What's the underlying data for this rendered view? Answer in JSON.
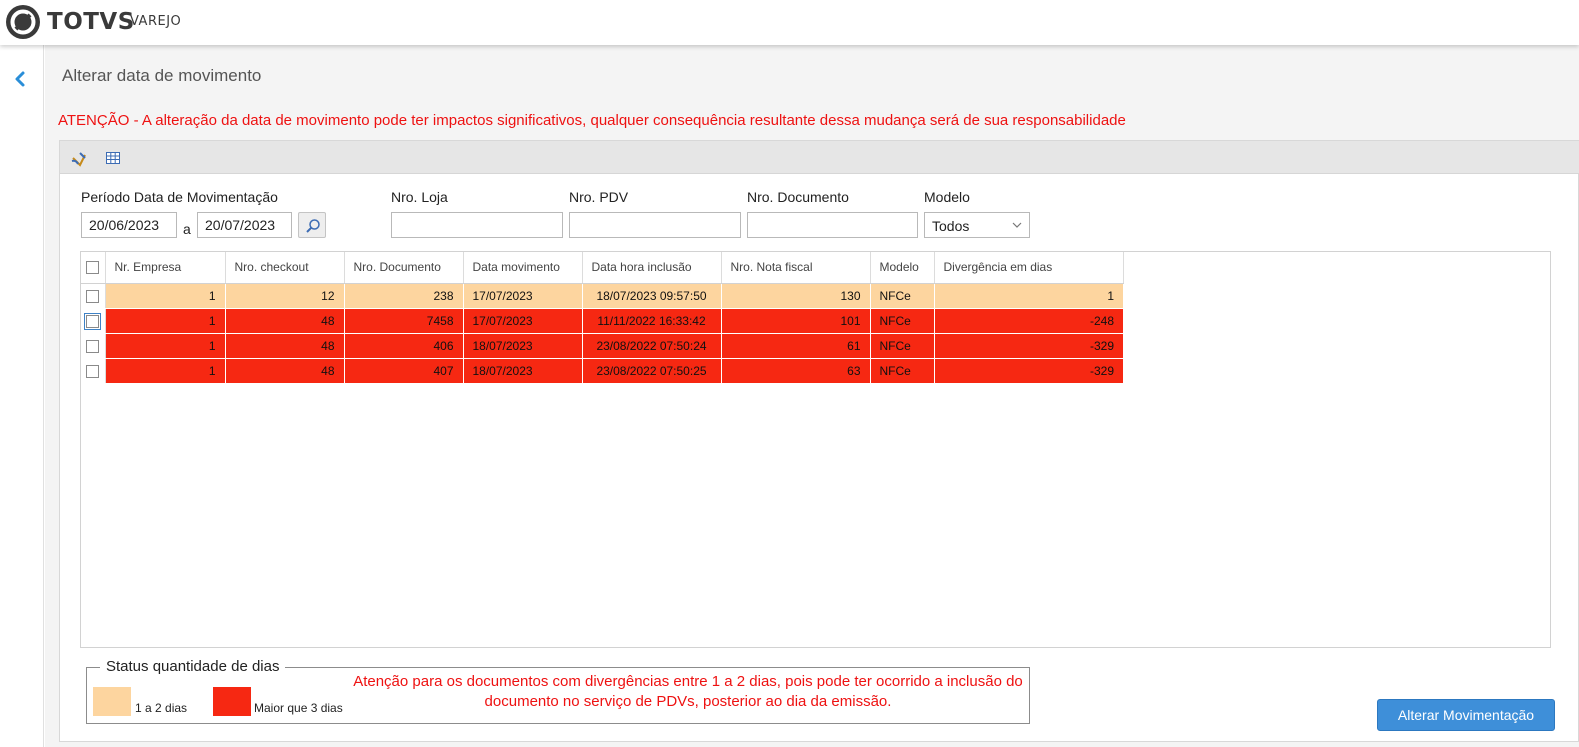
{
  "header": {
    "brand": "TOTVS",
    "brand_sub": "VAREJO"
  },
  "page": {
    "title": "Alterar data de movimento",
    "warning": "ATENÇÃO - A alteração da data de movimento pode ter impactos significativos, qualquer consequência resultante dessa mudança será de sua responsabilidade"
  },
  "toolbar": {
    "icons": [
      "clear-filter-icon",
      "grid-icon"
    ]
  },
  "filters": {
    "period_label": "Período Data de Movimentação",
    "date_from": "20/06/2023",
    "separator": "a",
    "date_to": "20/07/2023",
    "store_label": "Nro. Loja",
    "store_value": "",
    "pdv_label": "Nro. PDV",
    "pdv_value": "",
    "document_label": "Nro. Documento",
    "document_value": "",
    "model_label": "Modelo",
    "model_value": "Todos"
  },
  "grid": {
    "columns": [
      "Nr. Empresa",
      "Nro. checkout",
      "Nro. Documento",
      "Data movimento",
      "Data hora inclusão",
      "Nro. Nota fiscal",
      "Modelo",
      "Divergência em dias"
    ],
    "rows": [
      {
        "status": "1 a 2 dias",
        "color": "#fdd59f",
        "empresa": "1",
        "checkout": "12",
        "documento": "238",
        "data_movimento": "17/07/2023",
        "data_inclusao": "18/07/2023 09:57:50",
        "nota_fiscal": "130",
        "modelo": "NFCe",
        "divergencia": "1"
      },
      {
        "status": "Maior que 3 dias",
        "color": "#f62812",
        "empresa": "1",
        "checkout": "48",
        "documento": "7458",
        "data_movimento": "17/07/2023",
        "data_inclusao": "11/11/2022 16:33:42",
        "nota_fiscal": "101",
        "modelo": "NFCe",
        "divergencia": "-248"
      },
      {
        "status": "Maior que 3 dias",
        "color": "#f62812",
        "empresa": "1",
        "checkout": "48",
        "documento": "406",
        "data_movimento": "18/07/2023",
        "data_inclusao": "23/08/2022 07:50:24",
        "nota_fiscal": "61",
        "modelo": "NFCe",
        "divergencia": "-329"
      },
      {
        "status": "Maior que 3 dias",
        "color": "#f62812",
        "empresa": "1",
        "checkout": "48",
        "documento": "407",
        "data_movimento": "18/07/2023",
        "data_inclusao": "23/08/2022 07:50:25",
        "nota_fiscal": "63",
        "modelo": "NFCe",
        "divergencia": "-329"
      }
    ]
  },
  "legend": {
    "title": "Status quantidade de dias",
    "items": [
      {
        "label": "1 a 2 dias",
        "color": "#fdd59f"
      },
      {
        "label": "Maior que 3 dias",
        "color": "#f62812"
      }
    ],
    "note": "Atenção para os documentos com divergências entre 1 a 2 dias, pois pode ter ocorrido a inclusão do documento no serviço de PDVs, posterior ao dia da emissão."
  },
  "actions": {
    "primary_label": "Alterar Movimentação"
  },
  "colors": {
    "accent": "#3e8fd9",
    "warning_text": "#ee1111",
    "back_arrow": "#2a8ed8"
  }
}
